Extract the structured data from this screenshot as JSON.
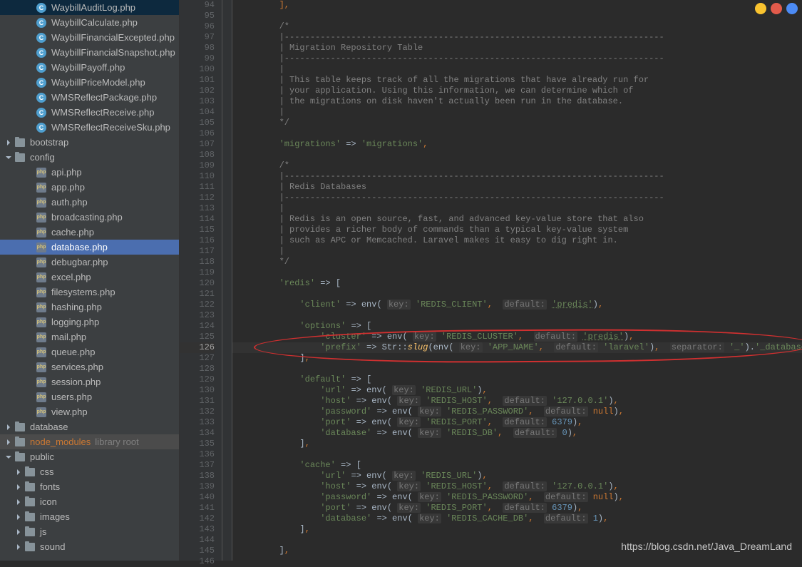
{
  "sidebar": {
    "files_top": [
      {
        "name": "WaybillAuditLog.php",
        "icon": "php-c"
      },
      {
        "name": "WaybillCalculate.php",
        "icon": "php-c"
      },
      {
        "name": "WaybillFinancialExcepted.php",
        "icon": "php-c"
      },
      {
        "name": "WaybillFinancialSnapshot.php",
        "icon": "php-c"
      },
      {
        "name": "WaybillPayoff.php",
        "icon": "php-c"
      },
      {
        "name": "WaybillPriceModel.php",
        "icon": "php-c"
      },
      {
        "name": "WMSReflectPackage.php",
        "icon": "php-c"
      },
      {
        "name": "WMSReflectReceive.php",
        "icon": "php-c"
      },
      {
        "name": "WMSReflectReceiveSku.php",
        "icon": "php-c"
      }
    ],
    "folders_mid": [
      {
        "name": "bootstrap",
        "icon": "folder",
        "expand": "right",
        "indent": 0
      },
      {
        "name": "config",
        "icon": "folder",
        "expand": "down",
        "indent": 0
      }
    ],
    "config_files": [
      {
        "name": "api.php"
      },
      {
        "name": "app.php"
      },
      {
        "name": "auth.php"
      },
      {
        "name": "broadcasting.php"
      },
      {
        "name": "cache.php"
      },
      {
        "name": "database.php",
        "selected": true
      },
      {
        "name": "debugbar.php"
      },
      {
        "name": "excel.php"
      },
      {
        "name": "filesystems.php"
      },
      {
        "name": "hashing.php"
      },
      {
        "name": "logging.php"
      },
      {
        "name": "mail.php"
      },
      {
        "name": "queue.php"
      },
      {
        "name": "services.php"
      },
      {
        "name": "session.php"
      },
      {
        "name": "users.php"
      },
      {
        "name": "view.php"
      }
    ],
    "folders_bottom": [
      {
        "name": "database",
        "icon": "folder",
        "expand": "right",
        "indent": 0
      },
      {
        "name": "node_modules",
        "icon": "folder",
        "expand": "right",
        "indent": 0,
        "lib": true,
        "note": "library root"
      },
      {
        "name": "public",
        "icon": "folder",
        "expand": "down",
        "indent": 0
      }
    ],
    "public_sub": [
      {
        "name": "css"
      },
      {
        "name": "fonts"
      },
      {
        "name": "icon"
      },
      {
        "name": "images"
      },
      {
        "name": "js"
      },
      {
        "name": "sound"
      }
    ]
  },
  "editor": {
    "first_line_no": 94,
    "current_line": 126,
    "lines": [
      {
        "n": 94,
        "t": "        ],",
        "cls": "punct"
      },
      {
        "n": 95,
        "t": ""
      },
      {
        "n": 96,
        "t": "        /*",
        "cls": "cmt"
      },
      {
        "n": 97,
        "t": "        |--------------------------------------------------------------------------",
        "cls": "cmt"
      },
      {
        "n": 98,
        "t": "        | Migration Repository Table",
        "cls": "cmt"
      },
      {
        "n": 99,
        "t": "        |--------------------------------------------------------------------------",
        "cls": "cmt"
      },
      {
        "n": 100,
        "t": "        |",
        "cls": "cmt"
      },
      {
        "n": 101,
        "t": "        | This table keeps track of all the migrations that have already run for",
        "cls": "cmt"
      },
      {
        "n": 102,
        "t": "        | your application. Using this information, we can determine which of",
        "cls": "cmt"
      },
      {
        "n": 103,
        "t": "        | the migrations on disk haven't actually been run in the database.",
        "cls": "cmt"
      },
      {
        "n": 104,
        "t": "        |",
        "cls": "cmt"
      },
      {
        "n": 105,
        "t": "        */",
        "cls": "cmt"
      },
      {
        "n": 106,
        "t": ""
      },
      {
        "n": 107,
        "html": "        <span class='str'>'migrations'</span> <span class='op'>=&gt;</span> <span class='str'>'migrations'</span><span class='punct'>,</span>"
      },
      {
        "n": 108,
        "t": ""
      },
      {
        "n": 109,
        "t": "        /*",
        "cls": "cmt"
      },
      {
        "n": 110,
        "t": "        |--------------------------------------------------------------------------",
        "cls": "cmt"
      },
      {
        "n": 111,
        "t": "        | Redis Databases",
        "cls": "cmt"
      },
      {
        "n": 112,
        "t": "        |--------------------------------------------------------------------------",
        "cls": "cmt"
      },
      {
        "n": 113,
        "t": "        |",
        "cls": "cmt"
      },
      {
        "n": 114,
        "t": "        | Redis is an open source, fast, and advanced key-value store that also",
        "cls": "cmt"
      },
      {
        "n": 115,
        "t": "        | provides a richer body of commands than a typical key-value system",
        "cls": "cmt"
      },
      {
        "n": 116,
        "t": "        | such as APC or Memcached. Laravel makes it easy to dig right in.",
        "cls": "cmt"
      },
      {
        "n": 117,
        "t": "        |",
        "cls": "cmt"
      },
      {
        "n": 118,
        "t": "        */",
        "cls": "cmt"
      },
      {
        "n": 119,
        "t": ""
      },
      {
        "n": 120,
        "html": "        <span class='str'>'redis'</span> <span class='op'>=&gt;</span> <span class='op'>[</span>"
      },
      {
        "n": 121,
        "t": ""
      },
      {
        "n": 122,
        "html": "            <span class='str'>'client'</span> <span class='op'>=&gt;</span> env( <span class='hint'>key:</span> <span class='str'>'REDIS_CLIENT'</span><span class='punct'>,</span>  <span class='hint'>default:</span> <span class='predis'>'predis'</span>)<span class='punct'>,</span>"
      },
      {
        "n": 123,
        "t": ""
      },
      {
        "n": 124,
        "html": "            <span class='str'>'options'</span> <span class='op'>=&gt;</span> <span class='op'>[</span>"
      },
      {
        "n": 125,
        "html": "                <span class='str'>'cluster'</span> <span class='op'>=&gt;</span> env( <span class='hint'>key:</span> <span class='str'>'REDIS_CLUSTER'</span><span class='punct'>,</span>  <span class='hint'>default:</span> <span class='predis'>'predis'</span>)<span class='punct'>,</span>"
      },
      {
        "n": 126,
        "html": "                <span class='str'>'prefix'</span> <span class='op'>=&gt;</span> Str::<span class='fn'>slug</span>(env( <span class='hint'>key:</span> <span class='str'>'APP_NAME'</span><span class='punct'>,</span>  <span class='hint'>default:</span> <span class='str'>'laravel'</span>)<span class='punct'>,</span>  <span class='hint'>separator:</span> <span class='str'>'_'</span>).<span class='str'>'_database_'</span><span class='punct'>,</span>"
      },
      {
        "n": 127,
        "html": "            ]<span class='punct'>,</span>"
      },
      {
        "n": 128,
        "t": ""
      },
      {
        "n": 129,
        "html": "            <span class='str'>'default'</span> <span class='op'>=&gt;</span> <span class='op'>[</span>"
      },
      {
        "n": 130,
        "html": "                <span class='str'>'url'</span> <span class='op'>=&gt;</span> env( <span class='hint'>key:</span> <span class='str'>'REDIS_URL'</span>)<span class='punct'>,</span>"
      },
      {
        "n": 131,
        "html": "                <span class='str'>'host'</span> <span class='op'>=&gt;</span> env( <span class='hint'>key:</span> <span class='str'>'REDIS_HOST'</span><span class='punct'>,</span>  <span class='hint'>default:</span> <span class='str'>'127.0.0.1'</span>)<span class='punct'>,</span>"
      },
      {
        "n": 132,
        "html": "                <span class='str'>'password'</span> <span class='op'>=&gt;</span> env( <span class='hint'>key:</span> <span class='str'>'REDIS_PASSWORD'</span><span class='punct'>,</span>  <span class='hint'>default:</span> <span class='kw'>null</span>)<span class='punct'>,</span>"
      },
      {
        "n": 133,
        "html": "                <span class='str'>'port'</span> <span class='op'>=&gt;</span> env( <span class='hint'>key:</span> <span class='str'>'REDIS_PORT'</span><span class='punct'>,</span>  <span class='hint'>default:</span> <span class='num'>6379</span>)<span class='punct'>,</span>"
      },
      {
        "n": 134,
        "html": "                <span class='str'>'database'</span> <span class='op'>=&gt;</span> env( <span class='hint'>key:</span> <span class='str'>'REDIS_DB'</span><span class='punct'>,</span>  <span class='hint'>default:</span> <span class='num'>0</span>)<span class='punct'>,</span>"
      },
      {
        "n": 135,
        "html": "            ]<span class='punct'>,</span>"
      },
      {
        "n": 136,
        "t": ""
      },
      {
        "n": 137,
        "html": "            <span class='str'>'cache'</span> <span class='op'>=&gt;</span> <span class='op'>[</span>"
      },
      {
        "n": 138,
        "html": "                <span class='str'>'url'</span> <span class='op'>=&gt;</span> env( <span class='hint'>key:</span> <span class='str'>'REDIS_URL'</span>)<span class='punct'>,</span>"
      },
      {
        "n": 139,
        "html": "                <span class='str'>'host'</span> <span class='op'>=&gt;</span> env( <span class='hint'>key:</span> <span class='str'>'REDIS_HOST'</span><span class='punct'>,</span>  <span class='hint'>default:</span> <span class='str'>'127.0.0.1'</span>)<span class='punct'>,</span>"
      },
      {
        "n": 140,
        "html": "                <span class='str'>'password'</span> <span class='op'>=&gt;</span> env( <span class='hint'>key:</span> <span class='str'>'REDIS_PASSWORD'</span><span class='punct'>,</span>  <span class='hint'>default:</span> <span class='kw'>null</span>)<span class='punct'>,</span>"
      },
      {
        "n": 141,
        "html": "                <span class='str'>'port'</span> <span class='op'>=&gt;</span> env( <span class='hint'>key:</span> <span class='str'>'REDIS_PORT'</span><span class='punct'>,</span>  <span class='hint'>default:</span> <span class='num'>6379</span>)<span class='punct'>,</span>"
      },
      {
        "n": 142,
        "html": "                <span class='str'>'database'</span> <span class='op'>=&gt;</span> env( <span class='hint'>key:</span> <span class='str'>'REDIS_CACHE_DB'</span><span class='punct'>,</span>  <span class='hint'>default:</span> <span class='num'>1</span>)<span class='punct'>,</span>"
      },
      {
        "n": 143,
        "html": "            ]<span class='punct'>,</span>"
      },
      {
        "n": 144,
        "t": ""
      },
      {
        "n": 145,
        "html": "        ]<span class='punct'>,</span>"
      },
      {
        "n": 146,
        "t": ""
      }
    ]
  },
  "watermark": "https://blog.csdn.net/Java_DreamLand"
}
